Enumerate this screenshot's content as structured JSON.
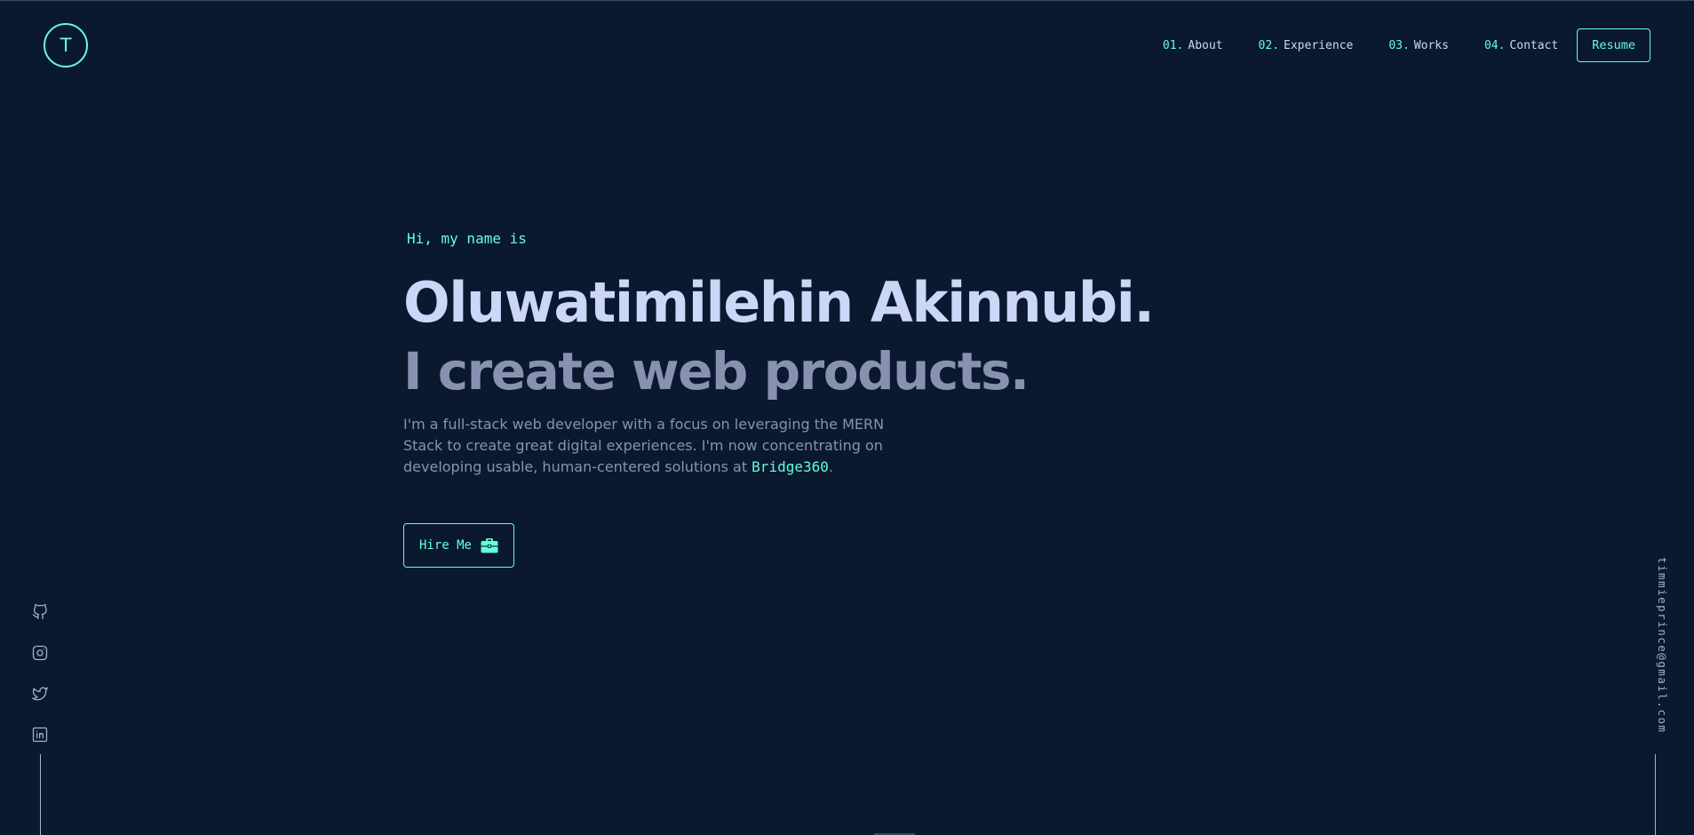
{
  "logo": {
    "letter": "T"
  },
  "nav": {
    "items": [
      {
        "num": "01.",
        "label": "About"
      },
      {
        "num": "02.",
        "label": "Experience"
      },
      {
        "num": "03.",
        "label": "Works"
      },
      {
        "num": "04.",
        "label": "Contact"
      }
    ],
    "resume_label": "Resume"
  },
  "hero": {
    "intro": "Hi, my name is",
    "name": "Oluwatimilehin Akinnubi.",
    "tagline": "I create web products.",
    "description_text": "I'm a full-stack web developer with a focus on leveraging the MERN Stack to create great digital experiences. I'm now concentrating on developing usable, human-centered solutions at ",
    "description_link": "Bridge360",
    "description_end": ".",
    "hire_label": "Hire Me",
    "hire_icon": "briefcase-icon"
  },
  "socials": [
    {
      "icon": "github-icon"
    },
    {
      "icon": "instagram-icon"
    },
    {
      "icon": "twitter-icon"
    },
    {
      "icon": "linkedin-icon"
    }
  ],
  "email": "timmieprince@gmail.com",
  "colors": {
    "background": "#0a192f",
    "accent": "#64ffda",
    "heading": "#ccd6f6",
    "text": "#8892b0"
  }
}
